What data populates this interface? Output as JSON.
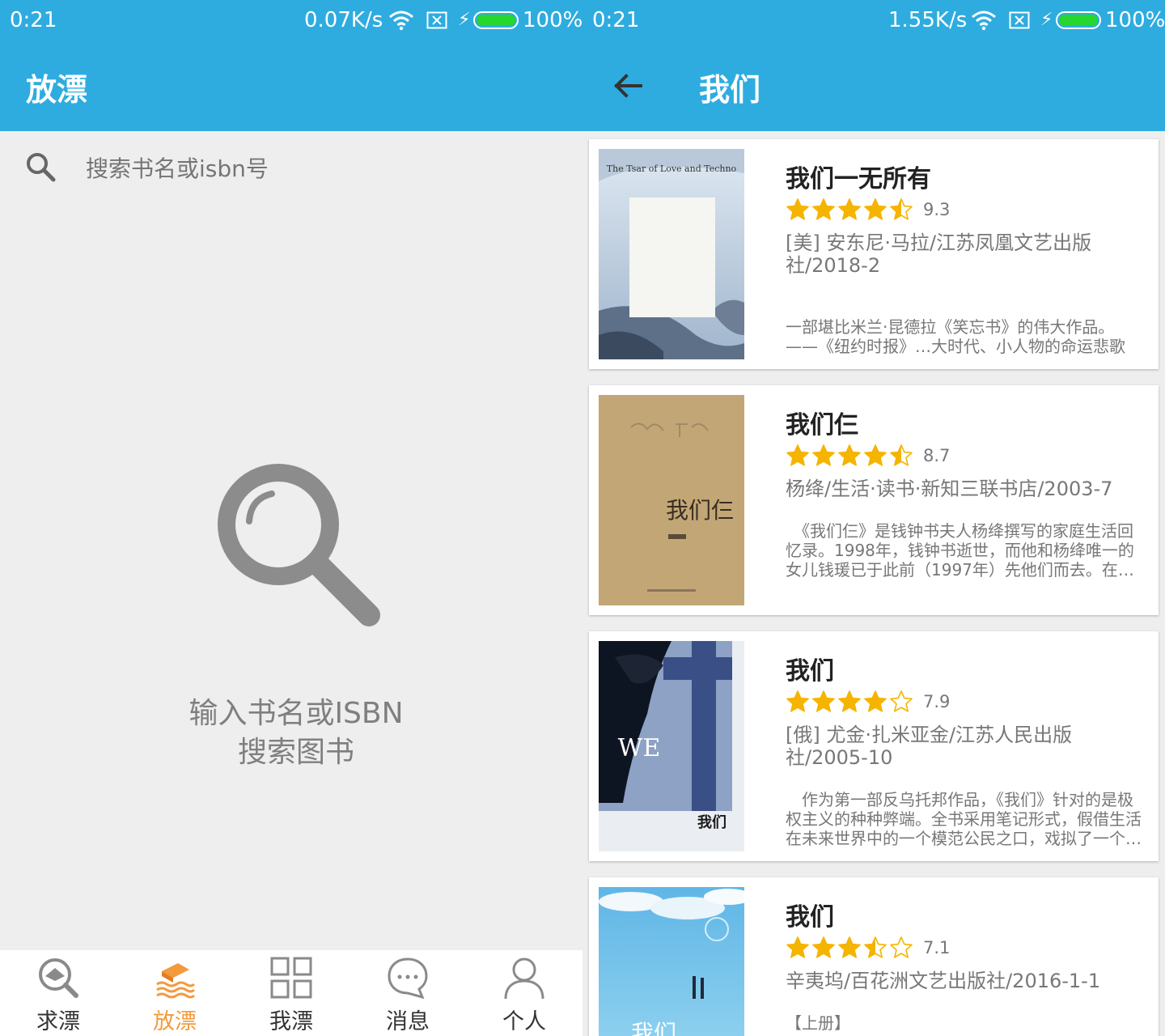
{
  "left": {
    "status": {
      "time": "0:21",
      "speed": "0.07K/s",
      "battery": "100%"
    },
    "appbar": {
      "title": "放漂"
    },
    "search": {
      "placeholder": "搜索书名或isbn号"
    },
    "empty": {
      "line1": "输入书名或ISBN",
      "line2": "搜索图书"
    },
    "nav": [
      {
        "label": "求漂",
        "icon": "book-search-icon",
        "active": false
      },
      {
        "label": "放漂",
        "icon": "book-float-icon",
        "active": true
      },
      {
        "label": "我漂",
        "icon": "grid-icon",
        "active": false
      },
      {
        "label": "消息",
        "icon": "chat-bubble-icon",
        "active": false
      },
      {
        "label": "个人",
        "icon": "person-icon",
        "active": false
      }
    ]
  },
  "right": {
    "status": {
      "time": "0:21",
      "speed": "1.55K/s",
      "battery": "100%"
    },
    "appbar": {
      "title": "我们"
    },
    "books": [
      {
        "title": "我们一无所有",
        "rating": 9.3,
        "score": "9.3",
        "meta": "[美] 安东尼·马拉/江苏凤凰文艺出版社/2018-2",
        "desc": "一部堪比米兰·昆德拉《笑忘书》的伟大作品。——《纽约时报》…大时代、小人物的命运悲歌",
        "cover_text": "The Tsar of Love and Techno"
      },
      {
        "title": "我们仨",
        "rating": 8.7,
        "score": "8.7",
        "meta": "杨绛/生活·读书·新知三联书店/2003-7",
        "desc": "　《我们仨》是钱钟书夫人杨绛撰写的家庭生活回忆录。1998年，钱钟书逝世，而他和杨绛唯一的女儿钱瑗已于此前（1997年）先他们而去。在…生l",
        "cover_text": "我们仨"
      },
      {
        "title": "我们",
        "rating": 7.9,
        "score": "7.9",
        "meta": "[俄] 尤金·扎米亚金/江苏人民出版社/2005-10",
        "desc": "　作为第一部反乌托邦作品，《我们》针对的是极权主义的种种弊端。全书采用笔记形式，假借生活在未来世界中的一个模范公民之口，戏拟了一个…卮",
        "cover_text": "WE"
      },
      {
        "title": "我们",
        "rating": 7.1,
        "score": "7.1",
        "meta": "辛夷坞/百花洲文艺出版社/2016-1-1",
        "desc": "【上册】",
        "cover_text": "我们"
      }
    ]
  },
  "colors": {
    "primary": "#2eace0",
    "accent": "#f39a3c",
    "star": "#f5b400"
  }
}
